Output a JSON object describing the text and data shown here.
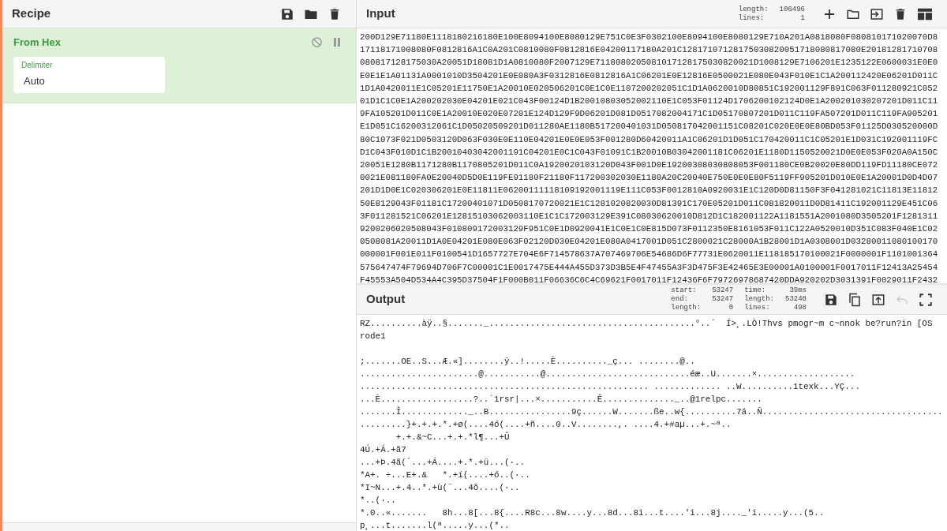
{
  "recipe": {
    "title": "Recipe",
    "operations": [
      {
        "name": "From Hex",
        "disabled": false,
        "paused": false,
        "args": [
          {
            "label": "Delimiter",
            "value": "Auto"
          }
        ]
      }
    ]
  },
  "input": {
    "title": "Input",
    "stats": [
      {
        "label": "length:",
        "value": "106496"
      },
      {
        "label": "lines:",
        "value": "1"
      }
    ],
    "lines": [
      "200D129E71180E1118180216180E100E8094100E8080129E751C0E3F0302100E8094100E8080129E710A201A0818080F080810171020070D8",
      "17118171008080F0812816A1C0A201C0810080F0812816E04200117180A201C12817107128175030820051718080817080E20181281710708",
      "080817128175030A20051D18081D1A0810080F2007129E7118080205081017128175030820021D1008129E7106201E1235122E0600031E0E0",
      "E0E1E1A01131A0001010D3504201E0E080A3F0312816E0812816A1C06201E0E12816E0500021E080E043F010E1C1A200112420E06201D011C",
      "1D1A0420011E1C05201E11750E1A20010E020506201C0E1C0E1107200202051C1D1A0620010D80851C192001129F891C063F011280921C052",
      "01D1C1C0E1A200202030E04201E021C043F00124D1B20010803052002110E1C053F01124D1706200102124D0E1A200201030207201D011C11",
      "9FA105201D011C0E1A20010E020E07201E124D129F9D06201D081D0517082004171C1D05170807201D011C119FA507201D011C119FA905201",
      "E1D051C16200312061C1D05020509201D011280AE1180B517200401031D050817042001151C08201C020E0E0E80BD053F01125D030520000D",
      "80C1073F021D0503120D063F030E0E110E04201E0E0E053F001280D60420011A1C06201D1D051C170420011C1C05201E1D031C192001119FC",
      "D1C043F010D1C1B20010403042001191C04201E0C1C043F01091C1B20010B03042001181C06201E1180D1150520021D0E0E053F020A0A150C",
      "20051E1280B1171280B1170805201D011C0A1920020103120D043F001D0E19200308030808053F001180CE0B20020E80DD119FD11180CE072",
      "0021E081180FA0E20040D5D0E119FE91180F21180F117200302030E1180A20C20040E750E0E0E80F5119FF905201D010E0E1A20001D0D4D07",
      "201D1D0E1C020306201E0E11811E06200111118109192001119E111C053F0012810A0920031E1C120D0D81150F3F041281021C11813E11812",
      "50E8129043F01181C17200401071D0508170720021E1C1281020820030D81391C170E05201D011C081820011D0D81411C192001129E451C06",
      "3F011281521C06201E12815103062003110E1C1C172003129E391C08030620010D812D1C182001122A1181551A2001080D3505201F1281311",
      "9200206020508043F010809172003129F951C0E1D0920041E1C0E1C0E815D073F0112350E8161053F011C122A0520010D351C083F040E1C02",
      "0508081A20011D1A0E04201E080E063F02120D030E04201E080A0417001D051C2800021C28000A1B28001D1A0308001D03280011080100170",
      "000001F001E011F0100541D1657727E704E6F714578637A707469706E54686D6F77731E0620011E118185170100021F0000001F1101001364",
      "575647474F79694D706F7C00001C1E0017475E444A455D373D3B5E4F47455A3F3D475F3E42465E3E00001A0100001F0017011F12413A25454",
      "F45553A504D534A4C395D37504F1F000B011F06636C6C4C69621F0017011F12436F6F79726978687420DDA920202D3031391F0029011F2432"
    ]
  },
  "output": {
    "title": "Output",
    "stats": [
      {
        "label": "start:",
        "value": "53247"
      },
      {
        "label": "time:",
        "value": "39ms"
      },
      {
        "label": "end:",
        "value": "53247"
      },
      {
        "label": "length:",
        "value": "53248"
      },
      {
        "label": "length:",
        "value": "0"
      },
      {
        "label": "lines:",
        "value": "498"
      }
    ],
    "undo_disabled": true,
    "paragraphs": [
      {
        "lines": [
          {
            "text": "RZ..........àÿ..§......._........................................°..´  Í>¸.LÒ!Thvs pmogr~m c~nnok be?run?in [OS"
          },
          {
            "text": "rode1"
          }
        ]
      },
      {
        "lines": [
          {
            "text": ";.......OE..S...Æ.«]........ÿ..!.....È.........._ç... ........@.."
          },
          {
            "text": ".......................@...........@............................éæ..U.......×..................."
          },
          {
            "text": "........................................................ ............. ..W..........1texk...YÇ..."
          },
          {
            "text": "...È..................?..`1rsr|...×...........Ê.............._..@1relpc......."
          },
          {
            "text": ".......Î............._..B................9ç......W.......ße..w{..........7á..Ñ..................................."
          },
          {
            "text": ".........}+.+.+.*.+ø(....4ó(....+ñ....0..V........,. ....4.+#aµ...+.~ª.."
          },
          {
            "text": "       +.+.&~C...+.+.*l¶...+Û"
          },
          {
            "text": "4Ú.+Á.+ã7"
          },
          {
            "text": "...+Þ.4ã(´...+Á....+.*.+ü...(·.."
          },
          {
            "text": "*A+. ÷...E+.&   *.+í(....+ó..(·.."
          },
          {
            "text": "*I~N...+.4..*.+ù(¨...4ô....(·.."
          },
          {
            "text": "*..(·.."
          },
          {
            "text": "*.0..«.......   8h...8[...8{....R8c...8w....y...8d...8i...t....'i...8j...._'i.....y...(5.."
          },
          {
            "text": "p¸...t.......l(ª.....y...(*.."
          }
        ]
      }
    ]
  }
}
